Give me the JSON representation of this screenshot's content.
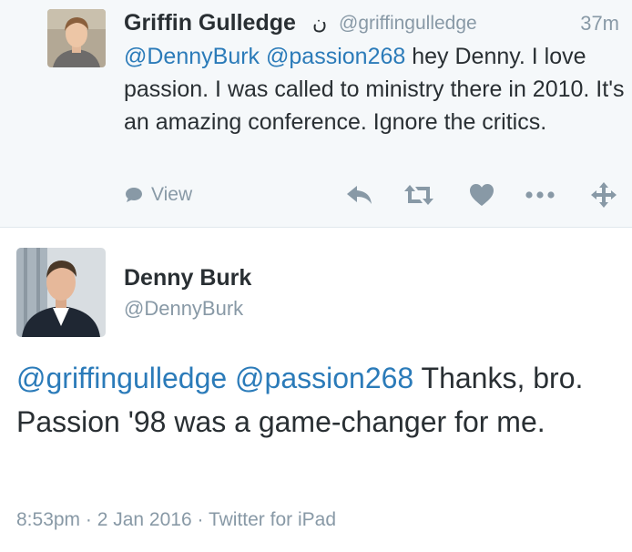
{
  "reply": {
    "author_name": "Griffin Gulledge",
    "verified_glyph": "ن",
    "handle": "@griffingulledge",
    "time_ago": "37m",
    "mention_1": "@DennyBurk",
    "mention_2": "@passion268",
    "text": " hey Denny. I love passion. I was called to ministry there in 2010. It's an amazing conference. Ignore the critics.",
    "view_label": "View",
    "action_icons": [
      "speech-bubble-icon",
      "reply-icon",
      "retweet-icon",
      "heart-icon",
      "more-icon",
      "move-icon"
    ]
  },
  "main_tweet": {
    "author_name": "Denny Burk",
    "handle": "@DennyBurk",
    "mention_1": "@griffingulledge",
    "mention_2": "@passion268",
    "text": " Thanks, bro. Passion '98 was a game-changer for me.",
    "timestamp": "8:53pm",
    "date": "2 Jan 2016",
    "source": "Twitter for iPad",
    "separator": " · "
  },
  "colors": {
    "link": "#2b7bb9",
    "muted": "#8899a6",
    "text": "#292f33",
    "reply_background": "#f5f8fa"
  }
}
